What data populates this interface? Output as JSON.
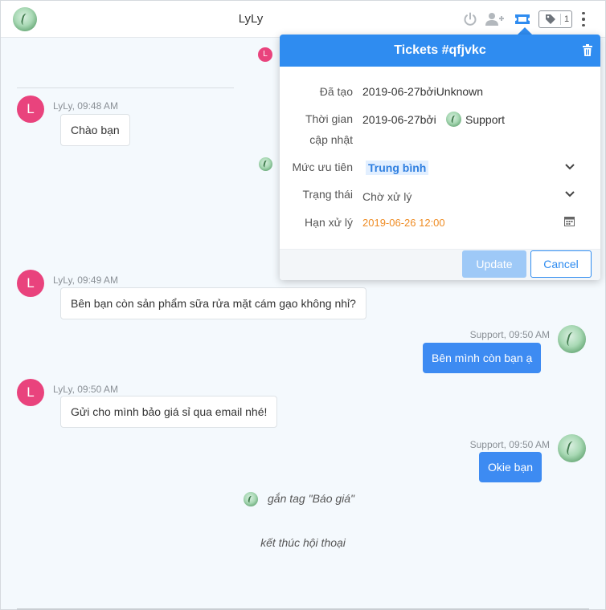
{
  "header": {
    "title": "LyLy",
    "icons": [
      "power-icon",
      "add-user-icon",
      "ticket-icon",
      "tag-icon",
      "kebab-menu-icon"
    ],
    "tag_count": "1",
    "accent": "#2f8cf0"
  },
  "messages": [
    {
      "sender": "LyLy",
      "initial": "L",
      "time": "LyLy, 09:48 AM",
      "text": "Chào bạn"
    },
    {
      "sender": "LyLy",
      "initial": "L",
      "time": "LyLy, 09:49 AM",
      "text": "Bên bạn còn sản phẩm sữa rửa mặt cám gạo không nhỉ?"
    },
    {
      "sender": "Support",
      "time": "Support, 09:50 AM",
      "text": "Bên mình còn bạn ạ"
    },
    {
      "sender": "LyLy",
      "initial": "L",
      "time": "LyLy, 09:50 AM",
      "text": "Gửi cho mình bảo giá sỉ qua email nhé!"
    },
    {
      "sender": "Support",
      "time": "Support, 09:50 AM",
      "text": "Okie bạn"
    }
  ],
  "system": {
    "tag_event": "gắn tag \"Báo giá\"",
    "end_event": "kết thúc hội thoại"
  },
  "pin_initial": "L",
  "ticket": {
    "title": "Tickets #qfjvkc",
    "created_label": "Đã tạo",
    "created_value": "2019-06-27bởiUnknown",
    "updated_label_1": "Thời gian",
    "updated_label_2": "cập nhật",
    "updated_value": "2019-06-27bởi",
    "updated_by": "Support",
    "priority_label": "Mức ưu tiên",
    "priority_value": "Trung bình",
    "status_label": "Trạng thái",
    "status_value": "Chờ xử lý",
    "deadline_label": "Hạn xử lý",
    "deadline_value": "2019-06-26 12:00",
    "update_button": "Update",
    "cancel_button": "Cancel"
  },
  "colors": {
    "user_avatar": "#e9437d",
    "support_bubble": "#3d8bf2",
    "deadline": "#ef8c24"
  }
}
